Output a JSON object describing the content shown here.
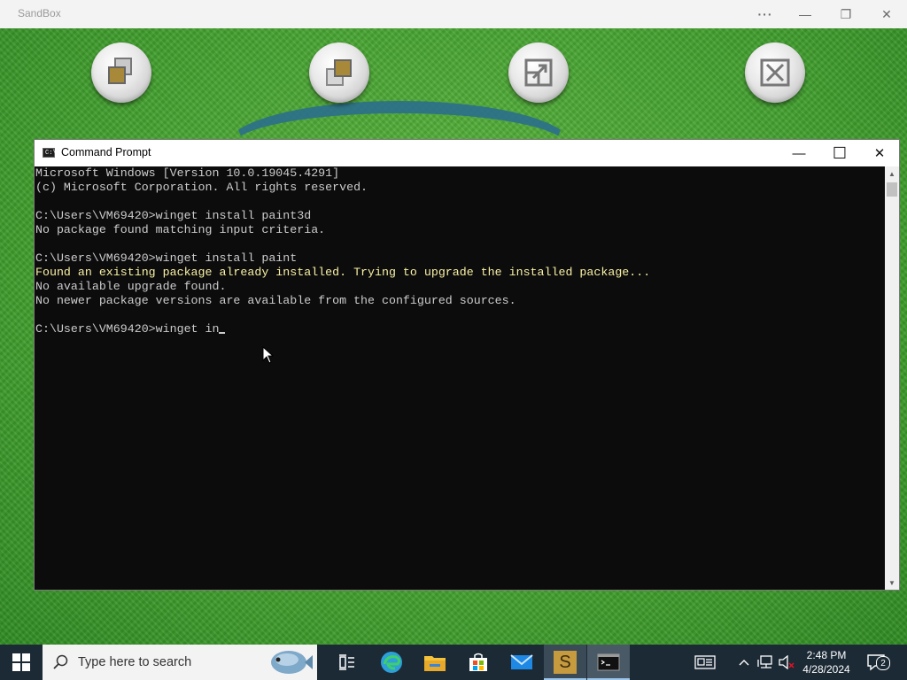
{
  "host": {
    "title": "SandBox",
    "more_label": "···",
    "minimize_label": "—",
    "restore_label": "❐",
    "close_label": "✕"
  },
  "desktop_buttons": [
    {
      "name": "restore-windows-button"
    },
    {
      "name": "cascade-windows-button"
    },
    {
      "name": "resize-window-button"
    },
    {
      "name": "close-all-button"
    }
  ],
  "cmd": {
    "title": "Command Prompt",
    "icon_text": "C:\\",
    "minimize_label": "—",
    "maximize_label": "☐",
    "close_label": "✕",
    "lines": [
      {
        "text": "Microsoft Windows [Version 10.0.19045.4291]",
        "color": "default"
      },
      {
        "text": "(c) Microsoft Corporation. All rights reserved.",
        "color": "default"
      },
      {
        "text": "",
        "color": "default"
      },
      {
        "text": "C:\\Users\\VM69420>winget install paint3d",
        "color": "default"
      },
      {
        "text": "No package found matching input criteria.",
        "color": "default"
      },
      {
        "text": "",
        "color": "default"
      },
      {
        "text": "C:\\Users\\VM69420>winget install paint",
        "color": "default"
      },
      {
        "text": "Found an existing package already installed. Trying to upgrade the installed package...",
        "color": "yellow"
      },
      {
        "text": "No available upgrade found.",
        "color": "default"
      },
      {
        "text": "No newer package versions are available from the configured sources.",
        "color": "default"
      },
      {
        "text": "",
        "color": "default"
      },
      {
        "text": "C:\\Users\\VM69420>winget in",
        "color": "default",
        "cursor": true
      }
    ],
    "colors": {
      "background": "#0c0c0c",
      "text": "#cccccc",
      "warning": "#f9f1a5"
    }
  },
  "taskbar": {
    "search_placeholder": "Type here to search",
    "pinned": [
      "task-view-icon",
      "edge-icon",
      "file-explorer-icon",
      "microsoft-store-icon",
      "mail-icon",
      "sandbox-app-icon",
      "command-prompt-icon"
    ],
    "sandbox_letter": "S",
    "tray": {
      "time": "2:48 PM",
      "date": "4/28/2024",
      "notification_count": "2"
    }
  }
}
